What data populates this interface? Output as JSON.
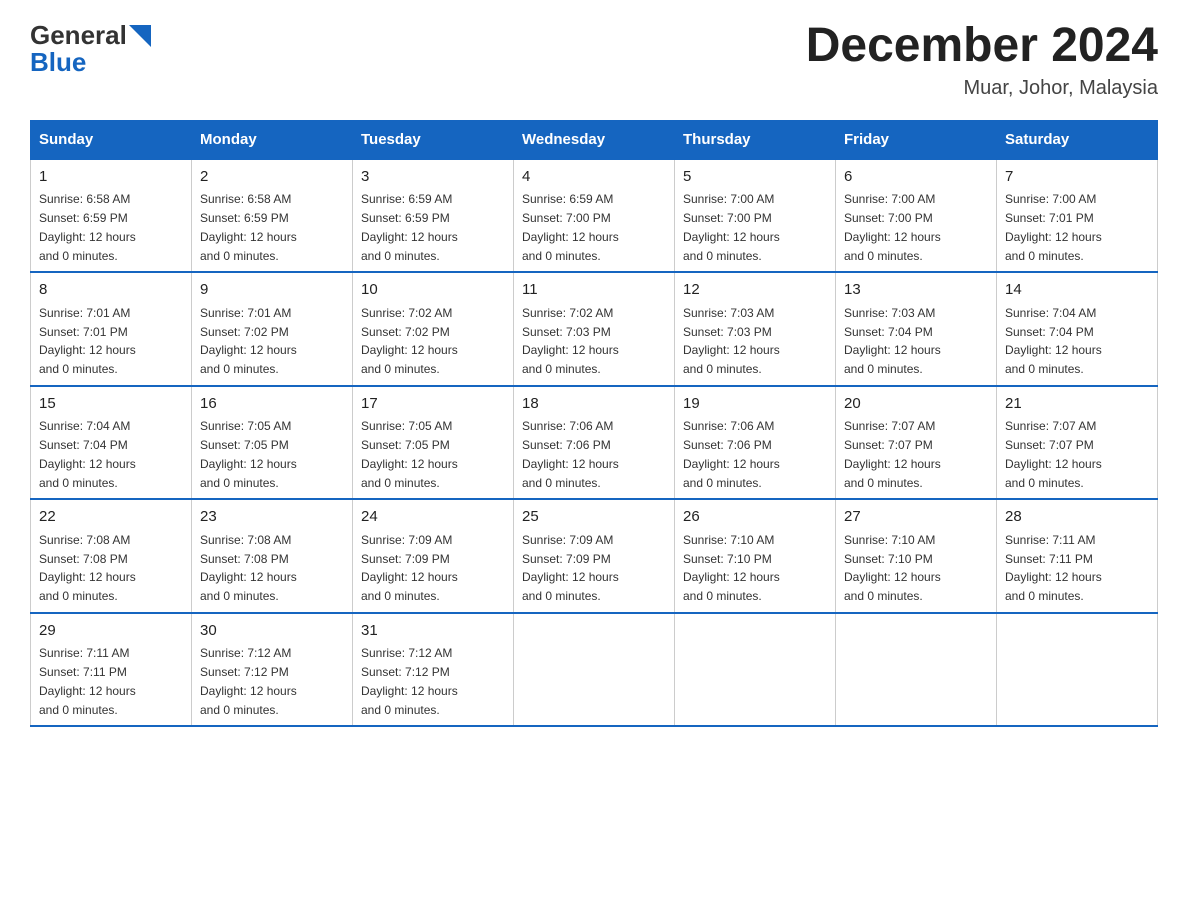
{
  "header": {
    "logo_general": "General",
    "logo_blue": "Blue",
    "month_title": "December 2024",
    "location": "Muar, Johor, Malaysia"
  },
  "days_of_week": [
    "Sunday",
    "Monday",
    "Tuesday",
    "Wednesday",
    "Thursday",
    "Friday",
    "Saturday"
  ],
  "weeks": [
    [
      {
        "day": "1",
        "sunrise": "6:58 AM",
        "sunset": "6:59 PM",
        "daylight": "12 hours and 0 minutes."
      },
      {
        "day": "2",
        "sunrise": "6:58 AM",
        "sunset": "6:59 PM",
        "daylight": "12 hours and 0 minutes."
      },
      {
        "day": "3",
        "sunrise": "6:59 AM",
        "sunset": "6:59 PM",
        "daylight": "12 hours and 0 minutes."
      },
      {
        "day": "4",
        "sunrise": "6:59 AM",
        "sunset": "7:00 PM",
        "daylight": "12 hours and 0 minutes."
      },
      {
        "day": "5",
        "sunrise": "7:00 AM",
        "sunset": "7:00 PM",
        "daylight": "12 hours and 0 minutes."
      },
      {
        "day": "6",
        "sunrise": "7:00 AM",
        "sunset": "7:00 PM",
        "daylight": "12 hours and 0 minutes."
      },
      {
        "day": "7",
        "sunrise": "7:00 AM",
        "sunset": "7:01 PM",
        "daylight": "12 hours and 0 minutes."
      }
    ],
    [
      {
        "day": "8",
        "sunrise": "7:01 AM",
        "sunset": "7:01 PM",
        "daylight": "12 hours and 0 minutes."
      },
      {
        "day": "9",
        "sunrise": "7:01 AM",
        "sunset": "7:02 PM",
        "daylight": "12 hours and 0 minutes."
      },
      {
        "day": "10",
        "sunrise": "7:02 AM",
        "sunset": "7:02 PM",
        "daylight": "12 hours and 0 minutes."
      },
      {
        "day": "11",
        "sunrise": "7:02 AM",
        "sunset": "7:03 PM",
        "daylight": "12 hours and 0 minutes."
      },
      {
        "day": "12",
        "sunrise": "7:03 AM",
        "sunset": "7:03 PM",
        "daylight": "12 hours and 0 minutes."
      },
      {
        "day": "13",
        "sunrise": "7:03 AM",
        "sunset": "7:04 PM",
        "daylight": "12 hours and 0 minutes."
      },
      {
        "day": "14",
        "sunrise": "7:04 AM",
        "sunset": "7:04 PM",
        "daylight": "12 hours and 0 minutes."
      }
    ],
    [
      {
        "day": "15",
        "sunrise": "7:04 AM",
        "sunset": "7:04 PM",
        "daylight": "12 hours and 0 minutes."
      },
      {
        "day": "16",
        "sunrise": "7:05 AM",
        "sunset": "7:05 PM",
        "daylight": "12 hours and 0 minutes."
      },
      {
        "day": "17",
        "sunrise": "7:05 AM",
        "sunset": "7:05 PM",
        "daylight": "12 hours and 0 minutes."
      },
      {
        "day": "18",
        "sunrise": "7:06 AM",
        "sunset": "7:06 PM",
        "daylight": "12 hours and 0 minutes."
      },
      {
        "day": "19",
        "sunrise": "7:06 AM",
        "sunset": "7:06 PM",
        "daylight": "12 hours and 0 minutes."
      },
      {
        "day": "20",
        "sunrise": "7:07 AM",
        "sunset": "7:07 PM",
        "daylight": "12 hours and 0 minutes."
      },
      {
        "day": "21",
        "sunrise": "7:07 AM",
        "sunset": "7:07 PM",
        "daylight": "12 hours and 0 minutes."
      }
    ],
    [
      {
        "day": "22",
        "sunrise": "7:08 AM",
        "sunset": "7:08 PM",
        "daylight": "12 hours and 0 minutes."
      },
      {
        "day": "23",
        "sunrise": "7:08 AM",
        "sunset": "7:08 PM",
        "daylight": "12 hours and 0 minutes."
      },
      {
        "day": "24",
        "sunrise": "7:09 AM",
        "sunset": "7:09 PM",
        "daylight": "12 hours and 0 minutes."
      },
      {
        "day": "25",
        "sunrise": "7:09 AM",
        "sunset": "7:09 PM",
        "daylight": "12 hours and 0 minutes."
      },
      {
        "day": "26",
        "sunrise": "7:10 AM",
        "sunset": "7:10 PM",
        "daylight": "12 hours and 0 minutes."
      },
      {
        "day": "27",
        "sunrise": "7:10 AM",
        "sunset": "7:10 PM",
        "daylight": "12 hours and 0 minutes."
      },
      {
        "day": "28",
        "sunrise": "7:11 AM",
        "sunset": "7:11 PM",
        "daylight": "12 hours and 0 minutes."
      }
    ],
    [
      {
        "day": "29",
        "sunrise": "7:11 AM",
        "sunset": "7:11 PM",
        "daylight": "12 hours and 0 minutes."
      },
      {
        "day": "30",
        "sunrise": "7:12 AM",
        "sunset": "7:12 PM",
        "daylight": "12 hours and 0 minutes."
      },
      {
        "day": "31",
        "sunrise": "7:12 AM",
        "sunset": "7:12 PM",
        "daylight": "12 hours and 0 minutes."
      },
      null,
      null,
      null,
      null
    ]
  ],
  "labels": {
    "sunrise": "Sunrise:",
    "sunset": "Sunset:",
    "daylight": "Daylight:"
  }
}
